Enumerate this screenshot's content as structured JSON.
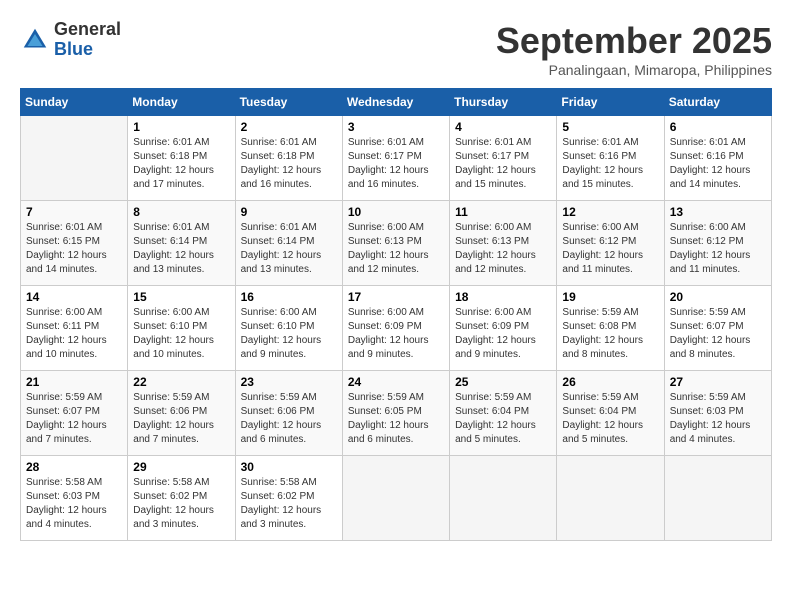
{
  "logo": {
    "general": "General",
    "blue": "Blue"
  },
  "title": "September 2025",
  "location": "Panalingaan, Mimaropa, Philippines",
  "headers": [
    "Sunday",
    "Monday",
    "Tuesday",
    "Wednesday",
    "Thursday",
    "Friday",
    "Saturday"
  ],
  "weeks": [
    [
      {
        "day": "",
        "info": ""
      },
      {
        "day": "1",
        "info": "Sunrise: 6:01 AM\nSunset: 6:18 PM\nDaylight: 12 hours\nand 17 minutes."
      },
      {
        "day": "2",
        "info": "Sunrise: 6:01 AM\nSunset: 6:18 PM\nDaylight: 12 hours\nand 16 minutes."
      },
      {
        "day": "3",
        "info": "Sunrise: 6:01 AM\nSunset: 6:17 PM\nDaylight: 12 hours\nand 16 minutes."
      },
      {
        "day": "4",
        "info": "Sunrise: 6:01 AM\nSunset: 6:17 PM\nDaylight: 12 hours\nand 15 minutes."
      },
      {
        "day": "5",
        "info": "Sunrise: 6:01 AM\nSunset: 6:16 PM\nDaylight: 12 hours\nand 15 minutes."
      },
      {
        "day": "6",
        "info": "Sunrise: 6:01 AM\nSunset: 6:16 PM\nDaylight: 12 hours\nand 14 minutes."
      }
    ],
    [
      {
        "day": "7",
        "info": "Sunrise: 6:01 AM\nSunset: 6:15 PM\nDaylight: 12 hours\nand 14 minutes."
      },
      {
        "day": "8",
        "info": "Sunrise: 6:01 AM\nSunset: 6:14 PM\nDaylight: 12 hours\nand 13 minutes."
      },
      {
        "day": "9",
        "info": "Sunrise: 6:01 AM\nSunset: 6:14 PM\nDaylight: 12 hours\nand 13 minutes."
      },
      {
        "day": "10",
        "info": "Sunrise: 6:00 AM\nSunset: 6:13 PM\nDaylight: 12 hours\nand 12 minutes."
      },
      {
        "day": "11",
        "info": "Sunrise: 6:00 AM\nSunset: 6:13 PM\nDaylight: 12 hours\nand 12 minutes."
      },
      {
        "day": "12",
        "info": "Sunrise: 6:00 AM\nSunset: 6:12 PM\nDaylight: 12 hours\nand 11 minutes."
      },
      {
        "day": "13",
        "info": "Sunrise: 6:00 AM\nSunset: 6:12 PM\nDaylight: 12 hours\nand 11 minutes."
      }
    ],
    [
      {
        "day": "14",
        "info": "Sunrise: 6:00 AM\nSunset: 6:11 PM\nDaylight: 12 hours\nand 10 minutes."
      },
      {
        "day": "15",
        "info": "Sunrise: 6:00 AM\nSunset: 6:10 PM\nDaylight: 12 hours\nand 10 minutes."
      },
      {
        "day": "16",
        "info": "Sunrise: 6:00 AM\nSunset: 6:10 PM\nDaylight: 12 hours\nand 9 minutes."
      },
      {
        "day": "17",
        "info": "Sunrise: 6:00 AM\nSunset: 6:09 PM\nDaylight: 12 hours\nand 9 minutes."
      },
      {
        "day": "18",
        "info": "Sunrise: 6:00 AM\nSunset: 6:09 PM\nDaylight: 12 hours\nand 9 minutes."
      },
      {
        "day": "19",
        "info": "Sunrise: 5:59 AM\nSunset: 6:08 PM\nDaylight: 12 hours\nand 8 minutes."
      },
      {
        "day": "20",
        "info": "Sunrise: 5:59 AM\nSunset: 6:07 PM\nDaylight: 12 hours\nand 8 minutes."
      }
    ],
    [
      {
        "day": "21",
        "info": "Sunrise: 5:59 AM\nSunset: 6:07 PM\nDaylight: 12 hours\nand 7 minutes."
      },
      {
        "day": "22",
        "info": "Sunrise: 5:59 AM\nSunset: 6:06 PM\nDaylight: 12 hours\nand 7 minutes."
      },
      {
        "day": "23",
        "info": "Sunrise: 5:59 AM\nSunset: 6:06 PM\nDaylight: 12 hours\nand 6 minutes."
      },
      {
        "day": "24",
        "info": "Sunrise: 5:59 AM\nSunset: 6:05 PM\nDaylight: 12 hours\nand 6 minutes."
      },
      {
        "day": "25",
        "info": "Sunrise: 5:59 AM\nSunset: 6:04 PM\nDaylight: 12 hours\nand 5 minutes."
      },
      {
        "day": "26",
        "info": "Sunrise: 5:59 AM\nSunset: 6:04 PM\nDaylight: 12 hours\nand 5 minutes."
      },
      {
        "day": "27",
        "info": "Sunrise: 5:59 AM\nSunset: 6:03 PM\nDaylight: 12 hours\nand 4 minutes."
      }
    ],
    [
      {
        "day": "28",
        "info": "Sunrise: 5:58 AM\nSunset: 6:03 PM\nDaylight: 12 hours\nand 4 minutes."
      },
      {
        "day": "29",
        "info": "Sunrise: 5:58 AM\nSunset: 6:02 PM\nDaylight: 12 hours\nand 3 minutes."
      },
      {
        "day": "30",
        "info": "Sunrise: 5:58 AM\nSunset: 6:02 PM\nDaylight: 12 hours\nand 3 minutes."
      },
      {
        "day": "",
        "info": ""
      },
      {
        "day": "",
        "info": ""
      },
      {
        "day": "",
        "info": ""
      },
      {
        "day": "",
        "info": ""
      }
    ]
  ]
}
